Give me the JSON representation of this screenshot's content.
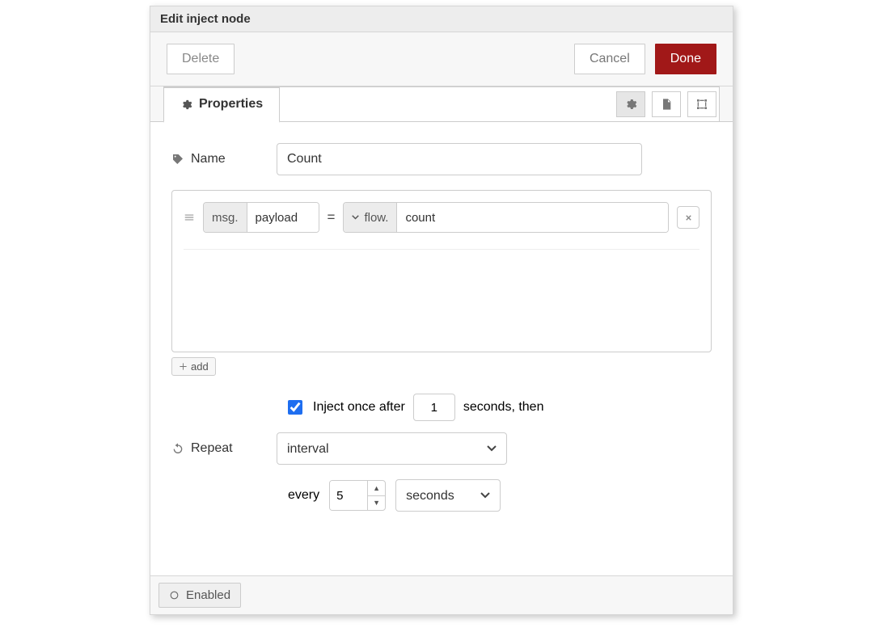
{
  "dialog": {
    "title": "Edit inject node",
    "delete": "Delete",
    "cancel": "Cancel",
    "done": "Done"
  },
  "tabs": {
    "properties": "Properties"
  },
  "form": {
    "name_label": "Name",
    "name_value": "Count",
    "equals": "=",
    "msg_prefix": "msg.",
    "msg_field": "payload",
    "value_type_prefix": "flow.",
    "value_field": "count",
    "add_button": "add",
    "inject_once_label": "Inject once after",
    "inject_once_value": "1",
    "inject_once_suffix": "seconds, then",
    "repeat_label": "Repeat",
    "repeat_mode": "interval",
    "every_label": "every",
    "every_value": "5",
    "every_unit": "seconds"
  },
  "footer": {
    "enabled": "Enabled"
  }
}
